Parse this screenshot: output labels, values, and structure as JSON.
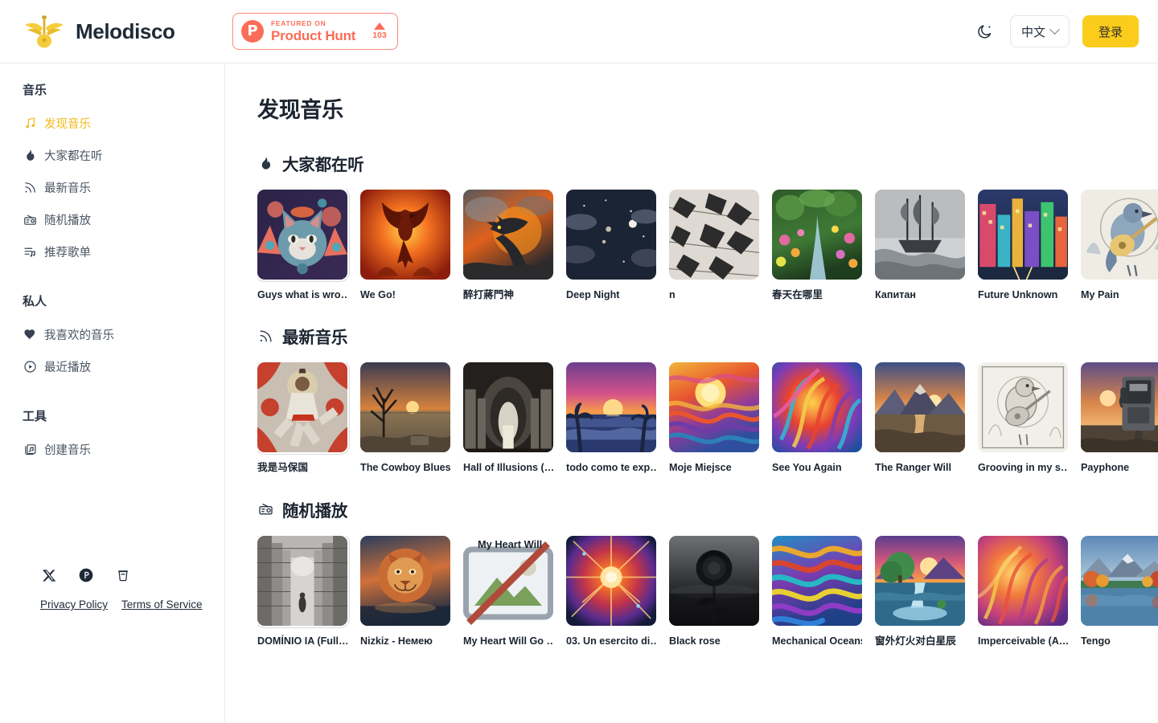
{
  "header": {
    "brand_name": "Melodisco",
    "logo_icon": "winged-guitar-logo",
    "product_hunt": {
      "small_text": "FEATURED ON",
      "big_text": "Product Hunt",
      "vote_count": "103",
      "badge_color": "#fb6d58",
      "p_letter": "P"
    },
    "theme_toggle_icon": "moon-icon",
    "language_label": "中文",
    "login_label": "登录",
    "login_color": "#fbcc1b"
  },
  "sidebar": {
    "groups": [
      {
        "title": "音乐",
        "items": [
          {
            "label": "发现音乐",
            "icon": "music-note-icon",
            "active": true
          },
          {
            "label": "大家都在听",
            "icon": "flame-icon",
            "active": false
          },
          {
            "label": "最新音乐",
            "icon": "rss-icon",
            "active": false
          },
          {
            "label": "随机播放",
            "icon": "radio-icon",
            "active": false
          },
          {
            "label": "推荐歌单",
            "icon": "playlist-icon",
            "active": false
          }
        ]
      },
      {
        "title": "私人",
        "items": [
          {
            "label": "我喜欢的音乐",
            "icon": "heart-filled-icon",
            "active": false
          },
          {
            "label": "最近播放",
            "icon": "play-circle-icon",
            "active": false
          }
        ]
      },
      {
        "title": "工具",
        "items": [
          {
            "label": "创建音乐",
            "icon": "create-music-icon",
            "active": false
          }
        ]
      }
    ],
    "socials": [
      {
        "name": "x-twitter-icon"
      },
      {
        "name": "product-hunt-icon"
      },
      {
        "name": "coffee-cup-icon"
      }
    ],
    "legal": [
      {
        "label": "Privacy Policy"
      },
      {
        "label": "Terms of Service"
      }
    ]
  },
  "main": {
    "page_title": "发现音乐",
    "sections": [
      {
        "title": "大家都在听",
        "icon": "flame-icon",
        "cards": [
          {
            "label": "Guys what is wro…",
            "art": "cosmic-cat",
            "ringed": true
          },
          {
            "label": "We Go!",
            "art": "fire-phoenix",
            "ringed": false
          },
          {
            "label": "醉打蔣門神",
            "art": "fire-dragon",
            "ringed": false
          },
          {
            "label": "Deep Night",
            "art": "moon-clouds",
            "ringed": false
          },
          {
            "label": "n",
            "art": "bw-debris",
            "ringed": false
          },
          {
            "label": "春天在哪里",
            "art": "forest-stream",
            "ringed": false
          },
          {
            "label": "Капитан",
            "art": "bw-ship",
            "ringed": false
          },
          {
            "label": "Future Unknown",
            "art": "neon-city",
            "ringed": false
          },
          {
            "label": "My Pain",
            "art": "bird-guitar",
            "ringed": false
          }
        ]
      },
      {
        "title": "最新音乐",
        "icon": "rss-icon",
        "cards": [
          {
            "label": "我是马保国",
            "art": "martial-artist",
            "ringed": true
          },
          {
            "label": "The Cowboy Blues",
            "art": "dry-tree",
            "ringed": false
          },
          {
            "label": "Hall of Illusions (…",
            "art": "dark-hall",
            "ringed": false
          },
          {
            "label": "todo como te exp…",
            "art": "sunset-palms",
            "ringed": false
          },
          {
            "label": "Moje Miejsce",
            "art": "psychedelic-sun",
            "ringed": false
          },
          {
            "label": "See You Again",
            "art": "color-swirl",
            "ringed": false
          },
          {
            "label": "The Ranger Will",
            "art": "mountain-dusk",
            "ringed": false
          },
          {
            "label": "Grooving in my s…",
            "art": "sketch-bird",
            "ringed": false
          },
          {
            "label": "Payphone",
            "art": "payphone-dusk",
            "ringed": false
          }
        ]
      },
      {
        "title": "随机播放",
        "icon": "radio-icon",
        "cards": [
          {
            "label": "DOMÍNIO IA (Full…",
            "art": "bw-corridor",
            "ringed": true
          },
          {
            "label": "Nizkiz - Немею",
            "art": "lion-mirror",
            "ringed": false
          },
          {
            "label": "My Heart Will Go …",
            "art": "broken-image",
            "ringed": false,
            "alt_text": "My Heart Will"
          },
          {
            "label": "03. Un esercito di…",
            "art": "cosmic-burst",
            "ringed": false
          },
          {
            "label": "Black rose",
            "art": "black-rose",
            "ringed": false
          },
          {
            "label": "Mechanical Oceans",
            "art": "rainbow-waves",
            "ringed": false
          },
          {
            "label": "窗外灯火对白星辰",
            "art": "waterfall-tree",
            "ringed": false
          },
          {
            "label": "Imperceivable (A…",
            "art": "orange-swirl",
            "ringed": false
          },
          {
            "label": "Tengo",
            "art": "autumn-lake",
            "ringed": false
          }
        ]
      }
    ]
  }
}
